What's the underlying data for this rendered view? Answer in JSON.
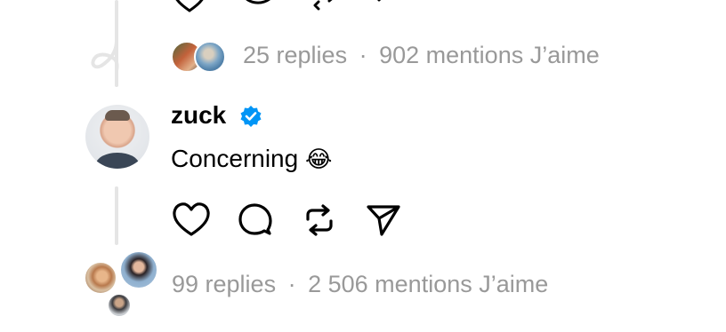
{
  "prev_post": {
    "replies_summary": {
      "replies": "25 replies",
      "separator": "·",
      "likes": "902 mentions J’aime"
    }
  },
  "post": {
    "username": "zuck",
    "verified_badge": "verified-badge-icon",
    "text": "Concerning",
    "emoji": "😂",
    "actions": [
      "heart-icon",
      "comment-icon",
      "repost-icon",
      "share-icon"
    ],
    "replies_summary": {
      "replies": "99 replies",
      "separator": "·",
      "likes": "2 506 mentions J’aime"
    }
  },
  "colors": {
    "meta_text": "#999999",
    "thread_line": "#e5e5e5",
    "verified_blue": "#0095f6"
  }
}
